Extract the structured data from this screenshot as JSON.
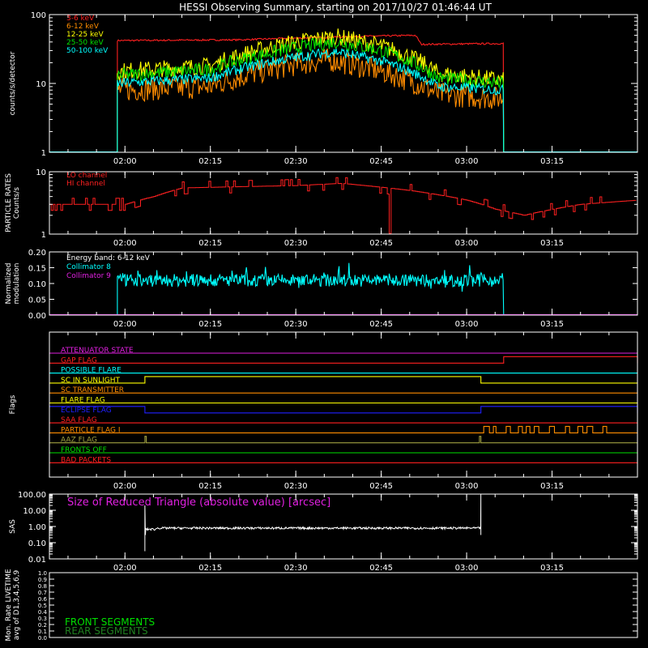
{
  "title": "HESSI Observing Summary, starting on 2017/10/27 01:46:44 UT",
  "time_ticks": [
    "02:00",
    "02:15",
    "02:30",
    "02:45",
    "03:00",
    "03:15"
  ],
  "colors": {
    "red": "#ff2020",
    "orange": "#ff8c00",
    "yellow": "#ffff00",
    "green": "#00e000",
    "cyan": "#00ffff",
    "magenta": "#e020e0",
    "blue": "#2020ff",
    "olive": "#a0a040",
    "white": "#ffffff"
  },
  "chart_data": [
    {
      "type": "line",
      "panel": "count_rates",
      "ylabel": "counts/s/detector",
      "yscale": "log",
      "ylim": [
        1,
        100
      ],
      "ytick_labels": [
        "1",
        "10",
        "100"
      ],
      "x_unit": "UT",
      "x_range": [
        "01:46:44",
        "03:30:00"
      ],
      "observing_interval": [
        "01:58:40",
        "03:06:30"
      ],
      "series": [
        {
          "name": "3-6 keV",
          "color": "#ff2020",
          "points": [
            [
              "01:58:40",
              42
            ],
            [
              "02:20:00",
              43
            ],
            [
              "02:40:00",
              48
            ],
            [
              "02:51:00",
              50
            ],
            [
              "02:52:00",
              37
            ],
            [
              "03:06:30",
              38
            ]
          ]
        },
        {
          "name": "6-12 keV",
          "color": "#ff8c00",
          "points": [
            [
              "01:58:40",
              8
            ],
            [
              "02:15:00",
              9
            ],
            [
              "02:30:00",
              19
            ],
            [
              "02:36:00",
              22
            ],
            [
              "02:45:00",
              15
            ],
            [
              "02:55:00",
              7
            ],
            [
              "03:06:30",
              6
            ]
          ]
        },
        {
          "name": "12-25 keV",
          "color": "#ffff00",
          "points": [
            [
              "01:58:40",
              15
            ],
            [
              "02:15:00",
              18
            ],
            [
              "02:30:00",
              40
            ],
            [
              "02:37:00",
              48
            ],
            [
              "02:45:00",
              35
            ],
            [
              "02:55:00",
              14
            ],
            [
              "03:06:30",
              11
            ]
          ]
        },
        {
          "name": "25-50 keV",
          "color": "#00e000",
          "points": [
            [
              "01:58:40",
              13
            ],
            [
              "02:15:00",
              16
            ],
            [
              "02:30:00",
              33
            ],
            [
              "02:37:00",
              40
            ],
            [
              "02:45:00",
              30
            ],
            [
              "02:55:00",
              12
            ],
            [
              "03:06:30",
              10
            ]
          ]
        },
        {
          "name": "50-100 keV",
          "color": "#00ffff",
          "points": [
            [
              "01:58:40",
              10
            ],
            [
              "02:15:00",
              12
            ],
            [
              "02:30:00",
              24
            ],
            [
              "02:37:00",
              29
            ],
            [
              "02:45:00",
              21
            ],
            [
              "02:55:00",
              9
            ],
            [
              "03:06:30",
              8
            ]
          ]
        }
      ]
    },
    {
      "type": "line",
      "panel": "particle_rates",
      "ylabel": "PARTICLE RATES\nCounts/s",
      "yscale": "log",
      "ylim": [
        1,
        10
      ],
      "ytick_labels": [
        "1",
        "10"
      ],
      "series": [
        {
          "name": "LO channel",
          "color": "#ff2020",
          "points": [
            [
              "01:46:44",
              3.0
            ],
            [
              "02:00:00",
              3.0
            ],
            [
              "02:05:00",
              4.0
            ],
            [
              "02:10:00",
              5.5
            ],
            [
              "02:30:00",
              6.0
            ],
            [
              "02:38:00",
              6.5
            ],
            [
              "02:50:00",
              5.0
            ],
            [
              "03:00:00",
              3.5
            ],
            [
              "03:05:00",
              2.5
            ],
            [
              "03:10:00",
              2.0
            ],
            [
              "03:20:00",
              3.0
            ],
            [
              "03:30:00",
              3.5
            ]
          ]
        },
        {
          "name": "HI channel",
          "color": "#ff2020",
          "points": []
        }
      ]
    },
    {
      "type": "line",
      "panel": "modulation",
      "ylabel": "Normalized\nmodulation",
      "ylim": [
        0,
        0.2
      ],
      "ytick_labels": [
        "0.00",
        "0.05",
        "0.10",
        "0.15",
        "0.20"
      ],
      "annotation": "Energy band: 6-12 keV",
      "series": [
        {
          "name": "Collimator 8",
          "color": "#00ffff",
          "mean": 0.11,
          "points": [
            [
              "01:58:40",
              0.11
            ],
            [
              "03:06:30",
              0.11
            ]
          ]
        },
        {
          "name": "Collimator 9",
          "color": "#e020e0",
          "mean": 0.0,
          "points": []
        }
      ]
    },
    {
      "type": "line",
      "panel": "flags",
      "ylabel": "Flags",
      "series": [
        {
          "name": "ATTENUATOR STATE",
          "color": "#e020e0",
          "on_intervals": []
        },
        {
          "name": "GAP FLAG",
          "color": "#ff2020",
          "on_intervals": [
            [
              "03:06:30",
              "03:30:00"
            ]
          ]
        },
        {
          "name": "POSSIBLE FLARE",
          "color": "#00ffff",
          "on_intervals": []
        },
        {
          "name": "SC IN SUNLIGHT",
          "color": "#ffff00",
          "on_intervals": [
            [
              "02:03:30",
              "03:02:30"
            ]
          ]
        },
        {
          "name": "SC TRANSMITTER",
          "color": "#ff8c00",
          "on_intervals": []
        },
        {
          "name": "FLARE FLAG",
          "color": "#ffff00",
          "on_intervals": []
        },
        {
          "name": "ECLIPSE FLAG",
          "color": "#2020ff",
          "on_intervals": [
            [
              "01:46:44",
              "02:03:30"
            ],
            [
              "03:02:30",
              "03:30:00"
            ]
          ]
        },
        {
          "name": "SAA FLAG",
          "color": "#ff2020",
          "on_intervals": []
        },
        {
          "name": "PARTICLE FLAG I",
          "color": "#ff8c00",
          "on_intervals": [
            [
              "03:03:00",
              "03:25:00"
            ]
          ]
        },
        {
          "name": "AAZ FLAG",
          "color": "#a0a040",
          "on_intervals": [
            [
              "02:03:30",
              "02:03:45"
            ],
            [
              "03:02:15",
              "03:02:30"
            ]
          ]
        },
        {
          "name": "FRONTS OFF",
          "color": "#00e000",
          "on_intervals": []
        },
        {
          "name": "BAD PACKETS",
          "color": "#ff2020",
          "on_intervals": []
        }
      ]
    },
    {
      "type": "line",
      "panel": "sas",
      "ylabel": "SAS",
      "yscale": "log",
      "ylim": [
        0.01,
        100
      ],
      "ytick_labels": [
        "0.01",
        "0.10",
        "1.00",
        "10.00",
        "100.00"
      ],
      "annotation": "Size of Reduced Triangle (absolute value) [arcsec]",
      "series": [
        {
          "name": "Size of Reduced Triangle",
          "color": "#ffffff",
          "points": [
            [
              "02:03:30",
              0.8
            ],
            [
              "03:02:30",
              0.8
            ]
          ]
        }
      ]
    },
    {
      "type": "line",
      "panel": "livetime",
      "ylabel": "Mon. Rate LIVETIME\navg of D1,3,4,5,6,9",
      "ylim": [
        0,
        1
      ],
      "ytick_labels": [
        "0.0",
        "0.1",
        "0.2",
        "0.3",
        "0.4",
        "0.5",
        "0.6",
        "0.7",
        "0.8",
        "0.9",
        "1.0"
      ],
      "series": [
        {
          "name": "FRONT SEGMENTS",
          "color": "#00e000",
          "points": []
        },
        {
          "name": "REAR SEGMENTS",
          "color": "#208020",
          "points": []
        }
      ]
    }
  ]
}
